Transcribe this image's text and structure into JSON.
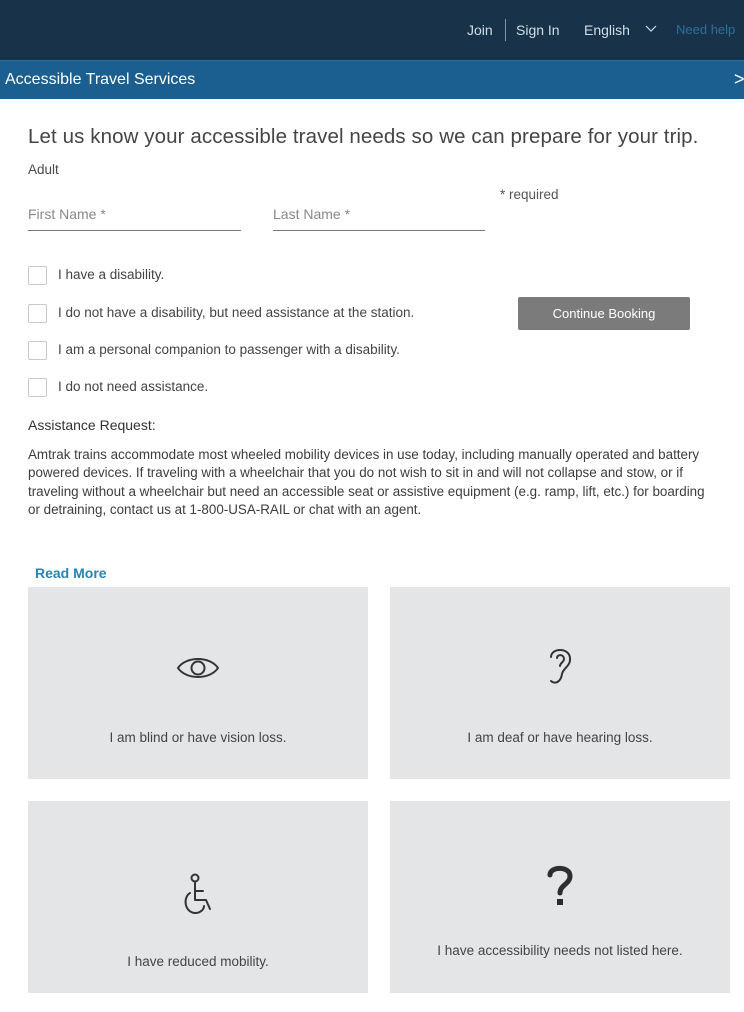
{
  "topnav": {
    "join": "Join",
    "sign_in": "Sign In",
    "language": "English",
    "need_help": "Need help"
  },
  "service_bar": {
    "title": "Accessible Travel Services",
    "close_glyph": ">"
  },
  "form": {
    "heading": "Let us know your accessible travel needs so we can prepare for your trip.",
    "passenger_type": "Adult",
    "required_note": "* required",
    "first_name_placeholder": "First Name *",
    "last_name_placeholder": "Last Name *",
    "options": [
      {
        "label": "I have a disability.",
        "checked": false
      },
      {
        "label": "I do not have a disability, but need assistance at the station.",
        "checked": false
      },
      {
        "label": "I am a personal companion to passenger with a disability.",
        "checked": false
      },
      {
        "label": "I do not need assistance.",
        "checked": false
      }
    ],
    "continue_label": "Continue Booking"
  },
  "assistance": {
    "title": "Assistance Request:",
    "body": "Amtrak trains accommodate most wheeled mobility devices in use today, including manually operated and battery powered devices. If traveling with a wheelchair that you do not wish to sit in and will not collapse and stow, or if traveling without a wheelchair but need an accessible seat or assistive equipment (e.g. ramp, lift, etc.) for boarding or detraining, contact us at 1-800-USA-RAIL or chat with an agent.",
    "read_more": "Read More"
  },
  "cards": [
    {
      "icon": "eye-icon",
      "label": "I am blind or have vision loss."
    },
    {
      "icon": "ear-icon",
      "label": "I am deaf or have hearing loss."
    },
    {
      "icon": "wheelchair-icon",
      "label": "I have reduced mobility."
    },
    {
      "icon": "question-mark-icon",
      "label": "I have accessibility needs not listed here."
    }
  ],
  "colors": {
    "topnav_bg": "#183349",
    "service_bar_bg": "#1a5f8f",
    "link": "#2a83b1",
    "button_bg": "#7b7b7b",
    "card_bg": "#e3e5e7"
  }
}
